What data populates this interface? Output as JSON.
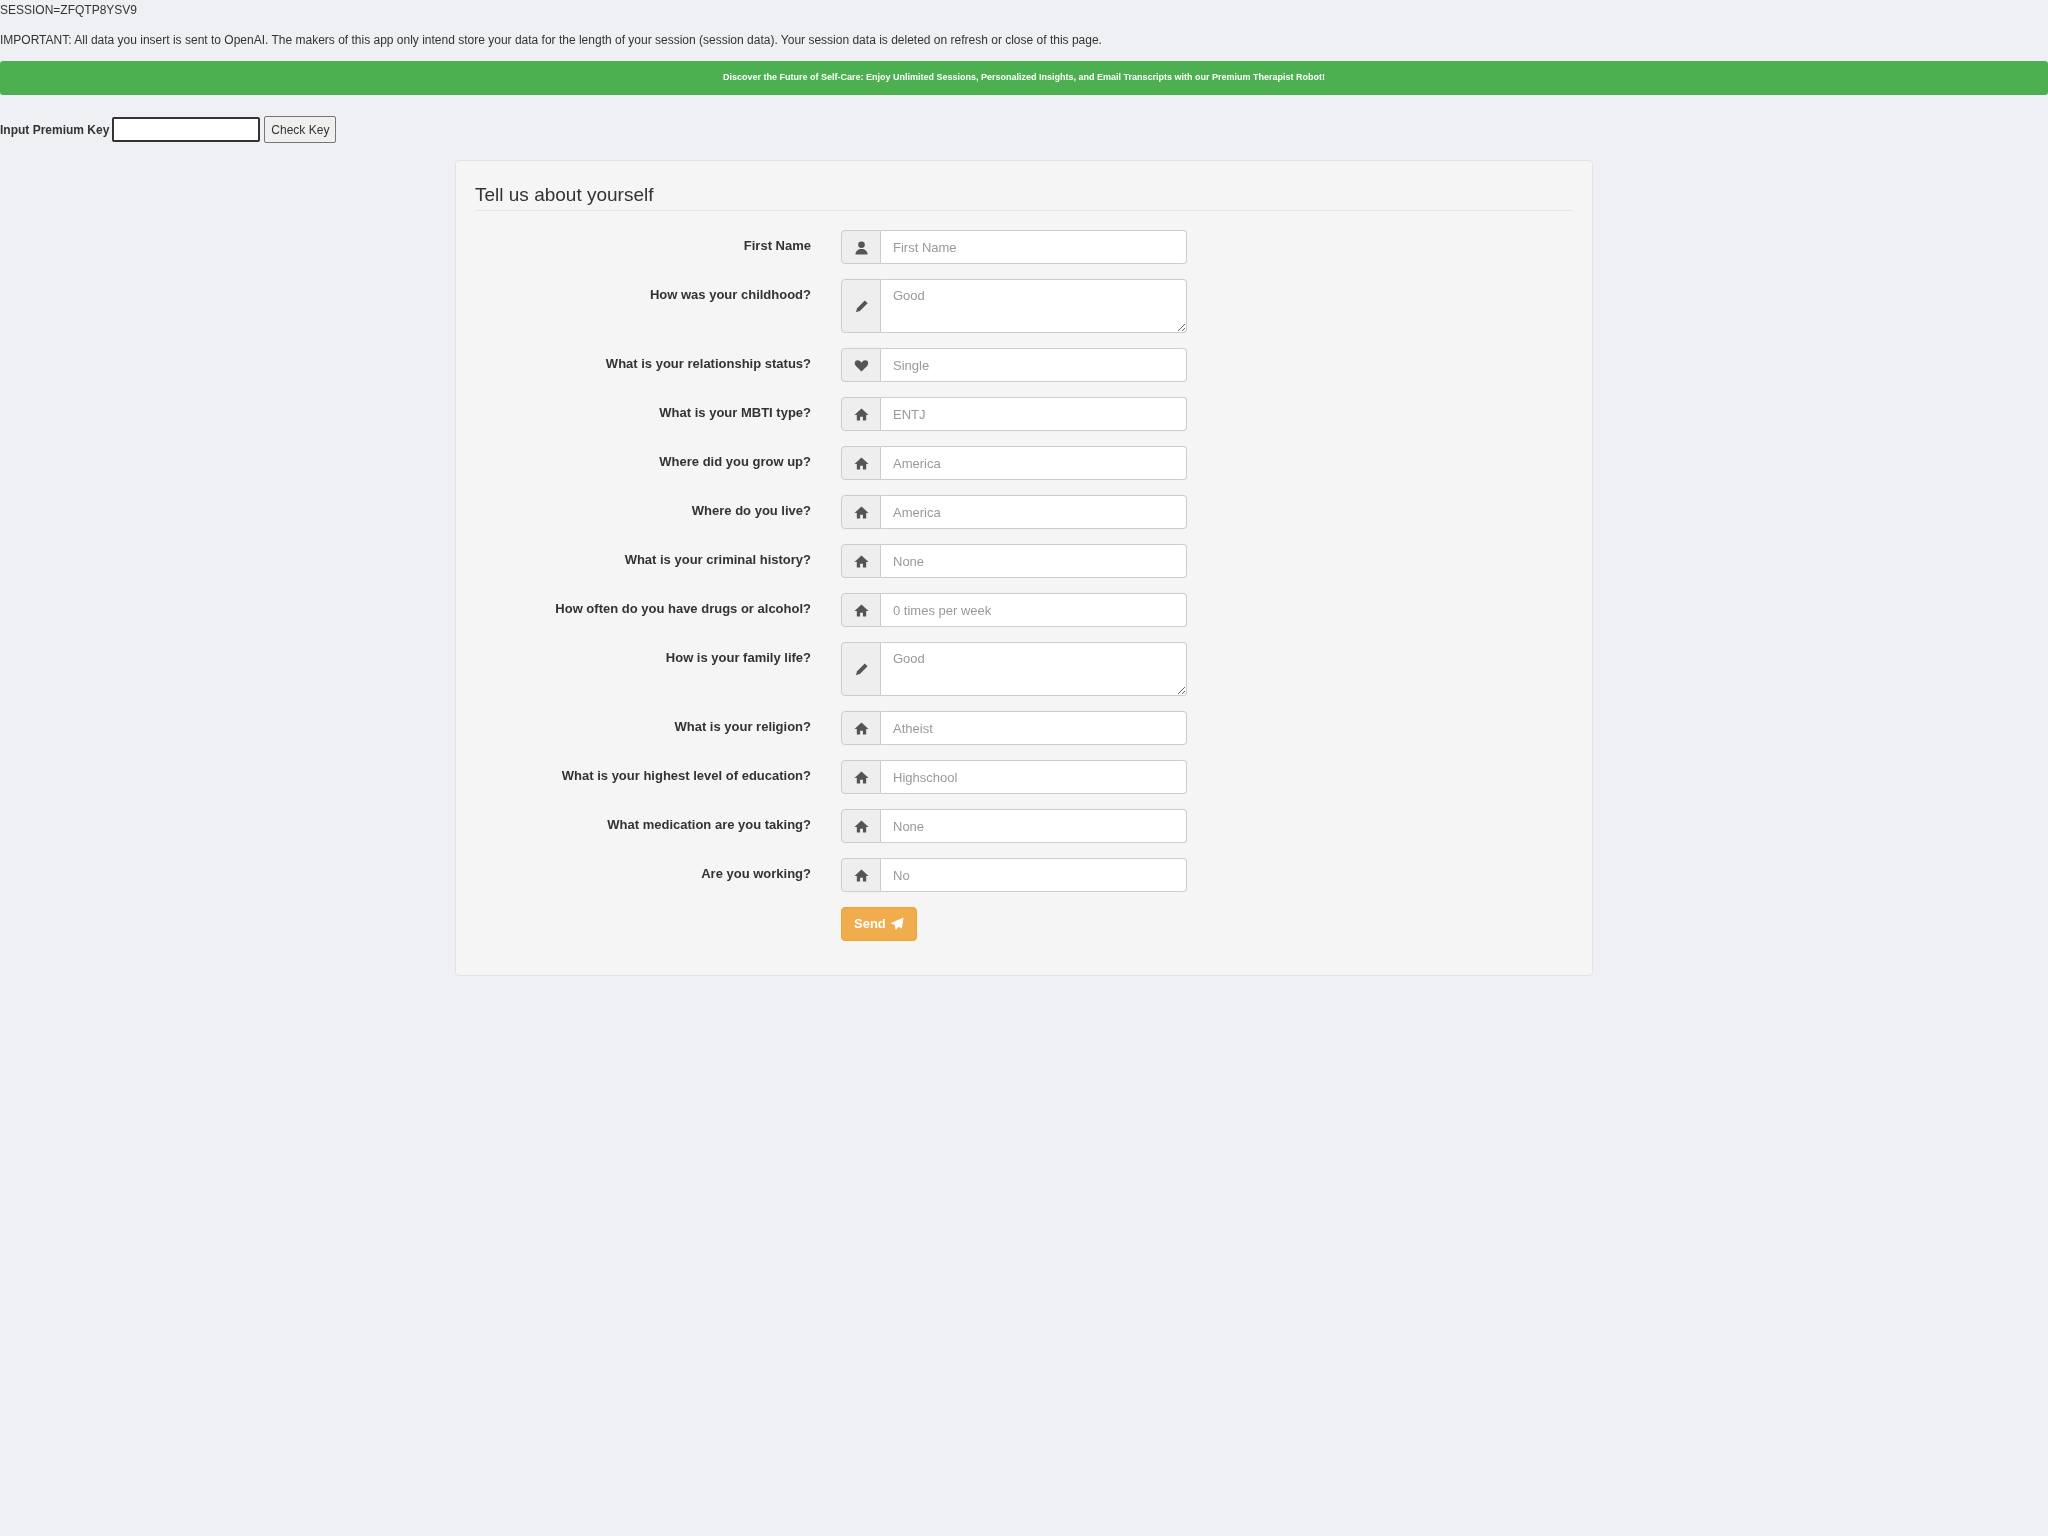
{
  "session": "SESSION=ZFQTP8YSV9",
  "notice": "IMPORTANT: All data you insert is sent to OpenAI. The makers of this app only intend store your data for the length of your session (session data). Your session data is deleted on refresh or close of this page.",
  "banner": "Discover the Future of Self-Care: Enjoy Unlimited Sessions, Personalized Insights, and Email Transcripts with our Premium Therapist Robot!",
  "premium": {
    "label": "Input Premium Key",
    "button": "Check Key"
  },
  "form": {
    "title": "Tell us about yourself",
    "fields": [
      {
        "label": "First Name",
        "placeholder": "First Name",
        "kind": "text"
      },
      {
        "label": "How was your childhood?",
        "placeholder": "Good",
        "kind": "textarea"
      },
      {
        "label": "What is your relationship status?",
        "placeholder": "Single",
        "kind": "text"
      },
      {
        "label": "What is your MBTI type?",
        "placeholder": "ENTJ",
        "kind": "text"
      },
      {
        "label": "Where did you grow up?",
        "placeholder": "America",
        "kind": "text"
      },
      {
        "label": "Where do you live?",
        "placeholder": "America",
        "kind": "text"
      },
      {
        "label": "What is your criminal history?",
        "placeholder": "None",
        "kind": "text"
      },
      {
        "label": "How often do you have drugs or alcohol?",
        "placeholder": "0 times per week",
        "kind": "text"
      },
      {
        "label": "How is your family life?",
        "placeholder": "Good",
        "kind": "textarea"
      },
      {
        "label": "What is your religion?",
        "placeholder": "Atheist",
        "kind": "text"
      },
      {
        "label": "What is your highest level of education?",
        "placeholder": "Highschool",
        "kind": "text"
      },
      {
        "label": "What medication are you taking?",
        "placeholder": "None",
        "kind": "text"
      },
      {
        "label": "Are you working?",
        "placeholder": "No",
        "kind": "text"
      }
    ],
    "submit": "Send"
  }
}
